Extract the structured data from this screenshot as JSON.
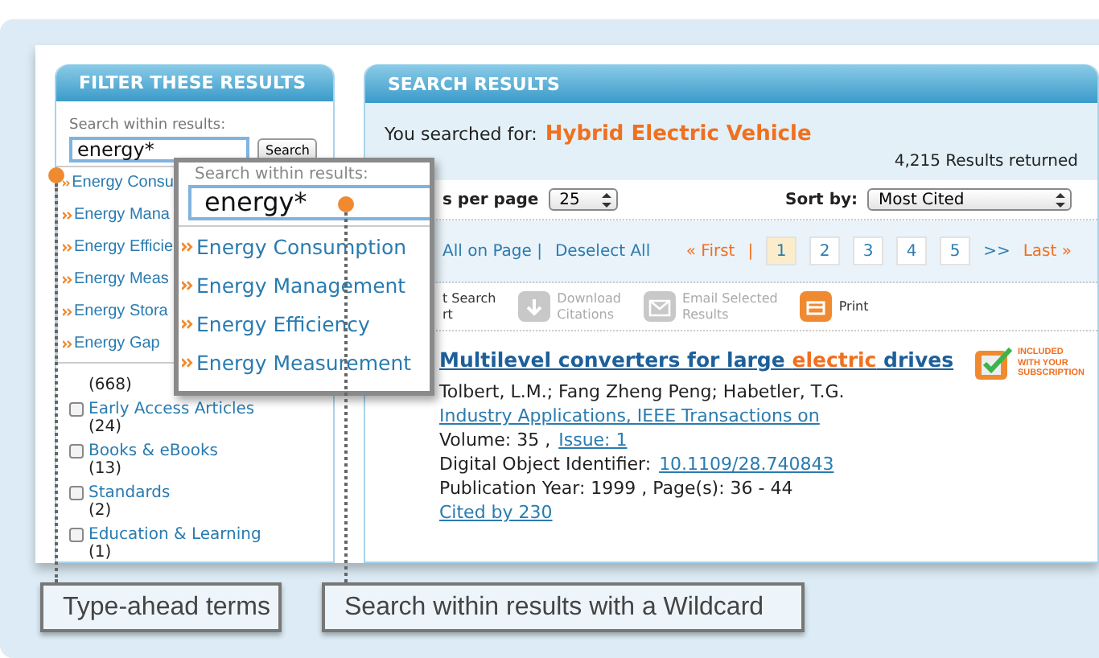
{
  "filter_panel": {
    "title": "FILTER THESE RESULTS",
    "search_label": "Search within results:",
    "search_value": "energy*",
    "search_button": "Search",
    "suggestions": [
      "Energy Consu",
      "Energy Mana",
      "Energy Efficie",
      "Energy Meas",
      "Energy Stora",
      "Energy Gap"
    ],
    "count_fragment": "(668)",
    "content_types": [
      {
        "label": "Early Access Articles",
        "count": "(24)",
        "checked": false
      },
      {
        "label": "Books & eBooks",
        "count": "(13)",
        "checked": false
      },
      {
        "label": "Standards",
        "count": "(2)",
        "checked": false
      },
      {
        "label": "Education & Learning",
        "count": "(1)",
        "checked": false
      }
    ]
  },
  "results_panel": {
    "title": "SEARCH RESULTS",
    "searched_for_label": "You searched for:",
    "query": "Hybrid Electric Vehicle",
    "results_count": "4,215 Results returned",
    "per_page_label": "s per page",
    "per_page_value": "25",
    "sort_label": "Sort by:",
    "sort_value": "Most Cited",
    "select_links": [
      "All on Page |",
      "Deselect All"
    ],
    "pagination": {
      "first": "« First",
      "separator": "|",
      "next": ">>",
      "last": "Last »",
      "pages": [
        {
          "label": "1",
          "selected": true
        },
        {
          "label": "2",
          "selected": false
        },
        {
          "label": "3",
          "selected": false
        },
        {
          "label": "4",
          "selected": false
        },
        {
          "label": "5",
          "selected": false
        }
      ]
    },
    "actions": [
      {
        "kind": "text",
        "label": "t Search",
        "sublabel": "rt",
        "disabled": false
      },
      {
        "kind": "download",
        "label": "Download",
        "sublabel": "Citations",
        "disabled": true
      },
      {
        "kind": "email",
        "label": "Email Selected",
        "sublabel": "Results",
        "disabled": true
      },
      {
        "kind": "print",
        "label": "Print",
        "disabled": false
      }
    ],
    "result": {
      "title_segments": [
        {
          "text": "Multilevel converters for large ",
          "highlight": false
        },
        {
          "text": "electric",
          "highlight": true
        },
        {
          "text": " drives",
          "highlight": false
        }
      ],
      "authors": "Tolbert, L.M.; Fang Zheng Peng; Habetler, T.G.",
      "publication": "Industry Applications, IEEE Transactions on",
      "volume": "Volume: 35 ,",
      "issue": "Issue: 1",
      "doi_label": "Digital Object Identifier:",
      "doi": "10.1109/28.740843",
      "year_pages": "Publication Year: 1999 , Page(s): 36 - 44",
      "cited_by": "Cited by 230",
      "badge": [
        "INCLUDED",
        "WITH YOUR",
        "SUBSCRIPTION"
      ]
    }
  },
  "zoom_popup": {
    "search_label": "Search within results:",
    "search_value": "energy*",
    "suggestions": [
      "Energy Consumption",
      "Energy Management",
      "Energy Efficiency",
      "Energy Measurement"
    ]
  },
  "callouts": [
    "Type-ahead terms",
    "Search within results with a Wildcard"
  ]
}
